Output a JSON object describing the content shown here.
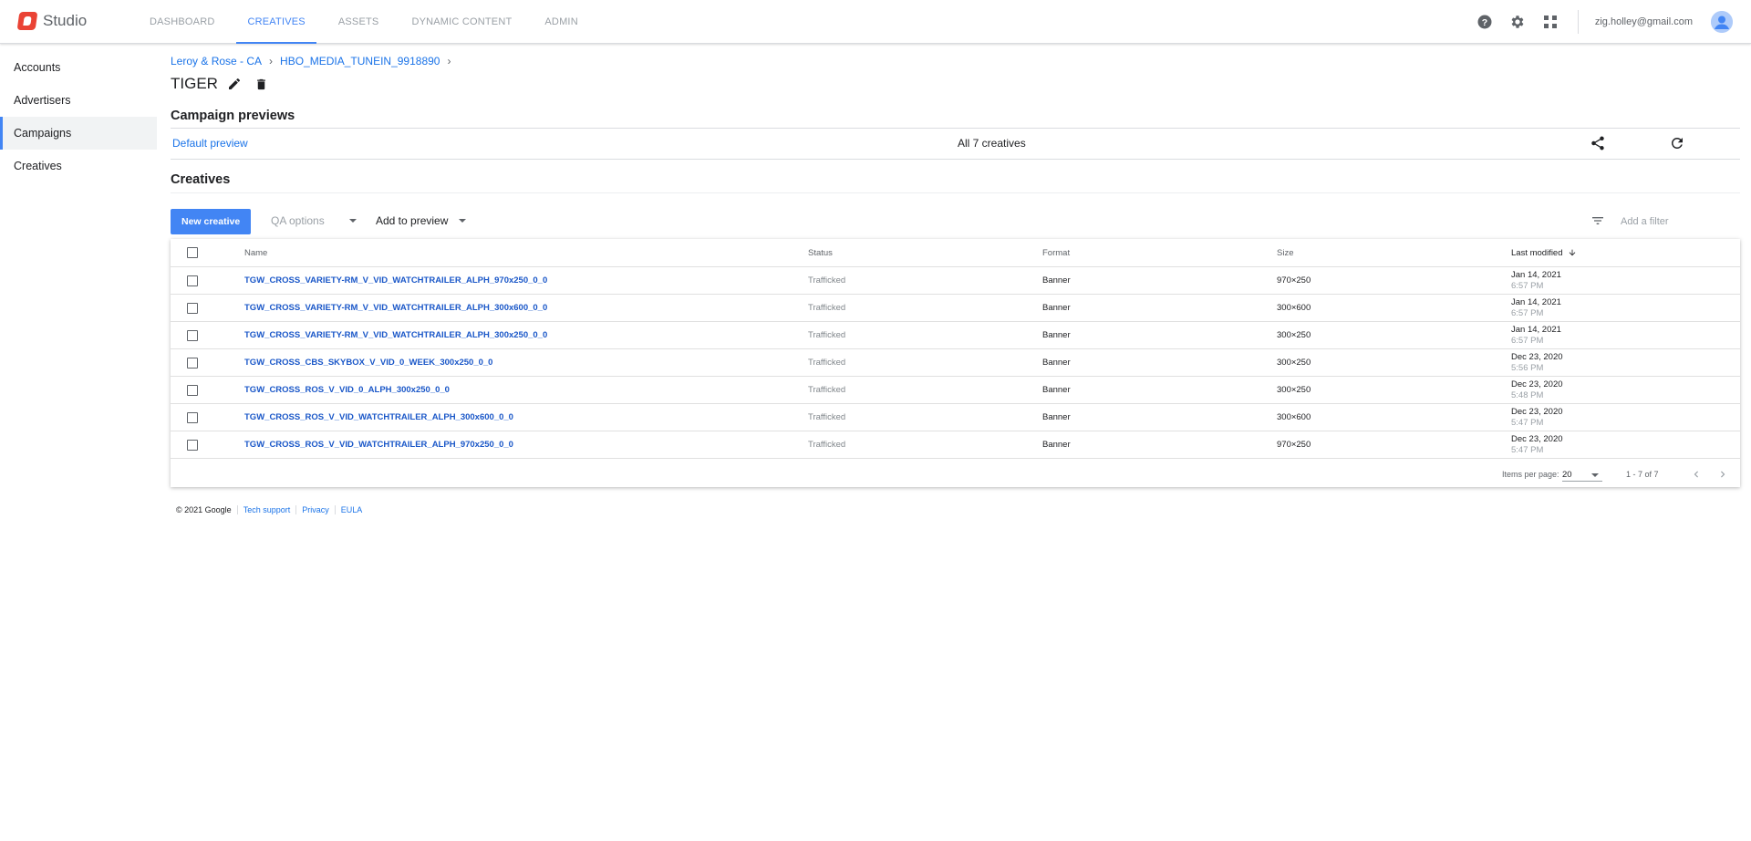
{
  "app": {
    "name": "Studio"
  },
  "nav": {
    "tabs": [
      {
        "label": "DASHBOARD"
      },
      {
        "label": "CREATIVES"
      },
      {
        "label": "ASSETS"
      },
      {
        "label": "DYNAMIC CONTENT"
      },
      {
        "label": "ADMIN"
      }
    ],
    "active_tab": "CREATIVES"
  },
  "user": {
    "email": "zig.holley@gmail.com"
  },
  "icons": {
    "help": "help-icon",
    "settings": "gear-icon",
    "apps": "apps-grid-icon",
    "avatar": "account-avatar-icon"
  },
  "sidebar": {
    "items": [
      {
        "label": "Accounts"
      },
      {
        "label": "Advertisers"
      },
      {
        "label": "Campaigns"
      },
      {
        "label": "Creatives"
      }
    ],
    "active": "Campaigns"
  },
  "breadcrumb": [
    {
      "label": "Leroy & Rose - CA"
    },
    {
      "label": "HBO_MEDIA_TUNEIN_9918890"
    }
  ],
  "page": {
    "title": "TIGER"
  },
  "previews": {
    "heading": "Campaign previews",
    "default_link": "Default preview",
    "count_text": "All 7 creatives"
  },
  "creatives": {
    "heading": "Creatives",
    "new_button": "New creative",
    "qa_options": "QA options",
    "add_to_preview": "Add to preview",
    "filter_placeholder": "Add a filter"
  },
  "table": {
    "columns": {
      "name": "Name",
      "status": "Status",
      "format": "Format",
      "size": "Size",
      "modified": "Last modified"
    },
    "rows": [
      {
        "name": "TGW_CROSS_VARIETY-RM_V_VID_WATCHTRAILER_ALPH_970x250_0_0",
        "status": "Trafficked",
        "format": "Banner",
        "size": "970×250",
        "date": "Jan 14, 2021",
        "time": "6:57 PM"
      },
      {
        "name": "TGW_CROSS_VARIETY-RM_V_VID_WATCHTRAILER_ALPH_300x600_0_0",
        "status": "Trafficked",
        "format": "Banner",
        "size": "300×600",
        "date": "Jan 14, 2021",
        "time": "6:57 PM"
      },
      {
        "name": "TGW_CROSS_VARIETY-RM_V_VID_WATCHTRAILER_ALPH_300x250_0_0",
        "status": "Trafficked",
        "format": "Banner",
        "size": "300×250",
        "date": "Jan 14, 2021",
        "time": "6:57 PM"
      },
      {
        "name": "TGW_CROSS_CBS_SKYBOX_V_VID_0_WEEK_300x250_0_0",
        "status": "Trafficked",
        "format": "Banner",
        "size": "300×250",
        "date": "Dec 23, 2020",
        "time": "5:56 PM"
      },
      {
        "name": "TGW_CROSS_ROS_V_VID_0_ALPH_300x250_0_0",
        "status": "Trafficked",
        "format": "Banner",
        "size": "300×250",
        "date": "Dec 23, 2020",
        "time": "5:48 PM"
      },
      {
        "name": "TGW_CROSS_ROS_V_VID_WATCHTRAILER_ALPH_300x600_0_0",
        "status": "Trafficked",
        "format": "Banner",
        "size": "300×600",
        "date": "Dec 23, 2020",
        "time": "5:47 PM"
      },
      {
        "name": "TGW_CROSS_ROS_V_VID_WATCHTRAILER_ALPH_970x250_0_0",
        "status": "Trafficked",
        "format": "Banner",
        "size": "970×250",
        "date": "Dec 23, 2020",
        "time": "5:47 PM"
      }
    ],
    "footer": {
      "items_per_page_label": "Items per page:",
      "items_per_page": "20",
      "range": "1 - 7 of 7"
    }
  },
  "footer": {
    "copyright": "© 2021 Google",
    "links": [
      {
        "label": "Tech support"
      },
      {
        "label": "Privacy"
      },
      {
        "label": "EULA"
      }
    ]
  },
  "colors": {
    "accent": "#4285f4",
    "link": "#1a73e8",
    "logo": "#ea4335"
  }
}
